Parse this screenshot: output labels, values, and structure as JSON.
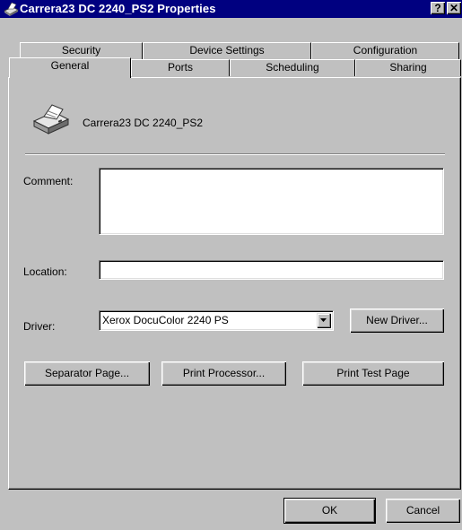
{
  "window": {
    "title": "Carrera23 DC 2240_PS2 Properties",
    "help_label": "?",
    "close_label": "✕"
  },
  "tabs_back": [
    "Security",
    "Device Settings",
    "Configuration"
  ],
  "tabs_front": [
    "General",
    "Ports",
    "Scheduling",
    "Sharing"
  ],
  "general": {
    "printer_name": "Carrera23 DC 2240_PS2",
    "comment_label": "Comment:",
    "comment_value": "",
    "location_label": "Location:",
    "location_value": "",
    "driver_label": "Driver:",
    "driver_value": "Xerox DocuColor 2240 PS",
    "new_driver_label": "New Driver...",
    "separator_page_label": "Separator Page...",
    "print_processor_label": "Print Processor...",
    "print_test_page_label": "Print Test Page"
  },
  "footer": {
    "ok_label": "OK",
    "cancel_label": "Cancel"
  },
  "colors": {
    "titlebar": "#000080",
    "face": "#c0c0c0"
  }
}
